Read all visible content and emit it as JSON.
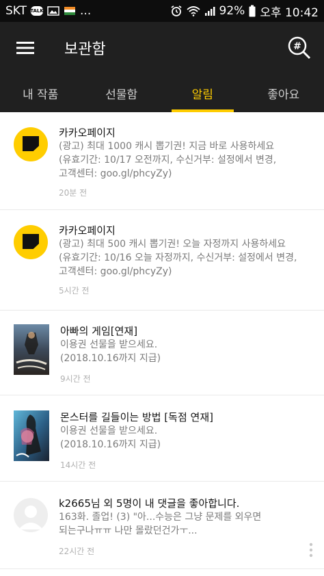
{
  "status_bar": {
    "carrier": "SKT",
    "talk_badge": "TALK",
    "dots": "...",
    "battery": "92%",
    "time": "오후 10:42"
  },
  "app_bar": {
    "title": "보관함",
    "search_icon": "#"
  },
  "tabs": [
    {
      "label": "내 작품",
      "active": false
    },
    {
      "label": "선물함",
      "active": false
    },
    {
      "label": "알림",
      "active": true
    },
    {
      "label": "좋아요",
      "active": false
    }
  ],
  "notifications": [
    {
      "title": "카카오페이지",
      "body": [
        "(광고) 최대 1000 캐시 뽑기권! 지금 바로 사용하세요",
        "(유효기간: 10/17 오전까지, 수신거부: 설정에서 변경,",
        "고객센터: goo.gl/phcyZy)"
      ],
      "time": "20분 전",
      "icon": "kakaopage-logo-icon"
    },
    {
      "title": "카카오페이지",
      "body": [
        "(광고) 최대 500 캐시 뽑기권! 오늘 자정까지 사용하세요",
        "(유효기간: 10/16 오늘 자정까지, 수신거부: 설정에서 변경,",
        "고객센터: goo.gl/phcyZy)"
      ],
      "time": "5시간 전",
      "icon": "kakaopage-logo-icon"
    },
    {
      "title": "아빠의 게임[연재]",
      "body": [
        "이용권 선물을 받으세요.",
        "(2018.10.16까지 지급)"
      ],
      "time": "9시간 전",
      "icon": "book-cover-thumbnail"
    },
    {
      "title": "몬스터를 길들이는 방법 [독점 연재]",
      "body": [
        "이용권 선물을 받으세요.",
        "(2018.10.16까지 지급)"
      ],
      "time": "14시간 전",
      "icon": "book-cover-thumbnail"
    },
    {
      "title": "k2665님 외 5명이 내 댓글을 좋아합니다.",
      "body": [
        "163화. 졸업! (3) \"아...수능은 그냥 문제를 외우면",
        "되는구나ㅠㅠ 나만 몰랐던건가ㅜ..."
      ],
      "time": "22시간 전",
      "icon": "user-avatar-placeholder"
    }
  ],
  "colors": {
    "accent": "#ffcd00",
    "appbar_bg": "#202020",
    "statusbar_bg": "#0d0d0d"
  }
}
